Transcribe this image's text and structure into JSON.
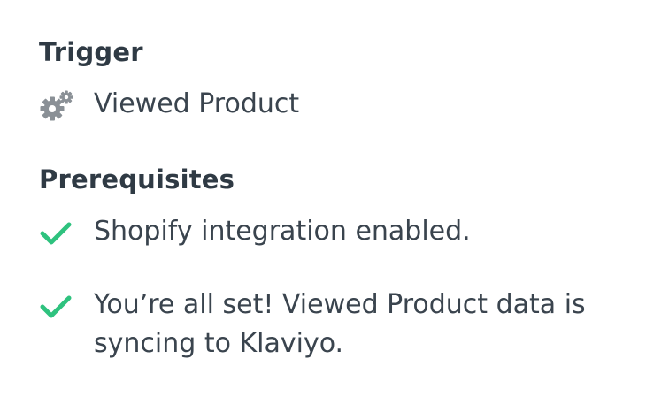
{
  "trigger": {
    "heading": "Trigger",
    "value": "Viewed Product",
    "icon": "gears-icon",
    "icon_color": "#8a9096"
  },
  "prerequisites": {
    "heading": "Prerequisites",
    "check_color": "#2ec27e",
    "items": [
      {
        "text": "Shopify integration enabled.",
        "icon": "checkmark-icon"
      },
      {
        "text": "You’re all set! Viewed Product data is syncing to Klaviyo.",
        "icon": "checkmark-icon"
      }
    ]
  }
}
